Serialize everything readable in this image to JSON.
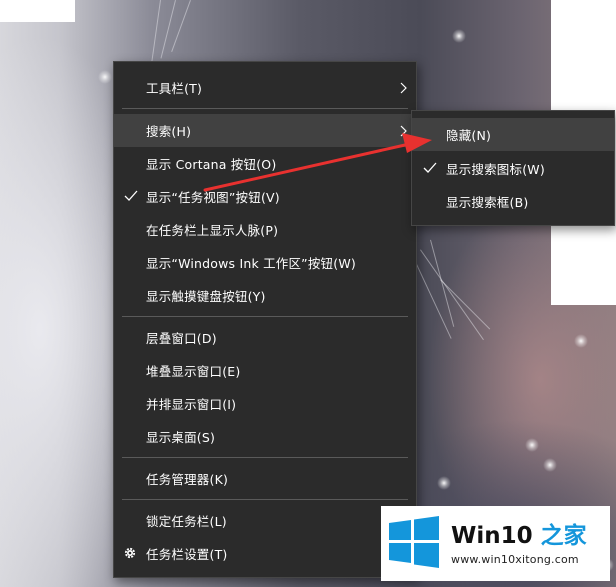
{
  "context_menu": {
    "items": [
      {
        "label": "工具栏(T)",
        "has_submenu": true
      },
      {
        "label": "搜索(H)",
        "has_submenu": true,
        "highlighted": true
      },
      {
        "label": "显示 Cortana 按钮(O)"
      },
      {
        "label": "显示“任务视图”按钮(V)",
        "checked": true
      },
      {
        "label": "在任务栏上显示人脉(P)"
      },
      {
        "label": "显示“Windows Ink 工作区”按钮(W)"
      },
      {
        "label": "显示触摸键盘按钮(Y)"
      },
      {
        "label": "层叠窗口(D)"
      },
      {
        "label": "堆叠显示窗口(E)"
      },
      {
        "label": "并排显示窗口(I)"
      },
      {
        "label": "显示桌面(S)"
      },
      {
        "label": "任务管理器(K)"
      },
      {
        "label": "锁定任务栏(L)"
      },
      {
        "label": "任务栏设置(T)",
        "icon": "gear-icon"
      }
    ]
  },
  "search_submenu": {
    "items": [
      {
        "label": "隐藏(N)",
        "highlighted": true
      },
      {
        "label": "显示搜索图标(W)",
        "checked": true
      },
      {
        "label": "显示搜索框(B)"
      }
    ]
  },
  "annotation": {
    "color": "#e8312f"
  },
  "watermark": {
    "brand_prefix": "Win10",
    "brand_suffix": "之家",
    "url": "www.win10xitong.com",
    "accent_color": "#1496db"
  },
  "colors": {
    "menu_bg": "#2b2b2b",
    "menu_hover": "#414141",
    "separator": "#5a5a5a"
  }
}
